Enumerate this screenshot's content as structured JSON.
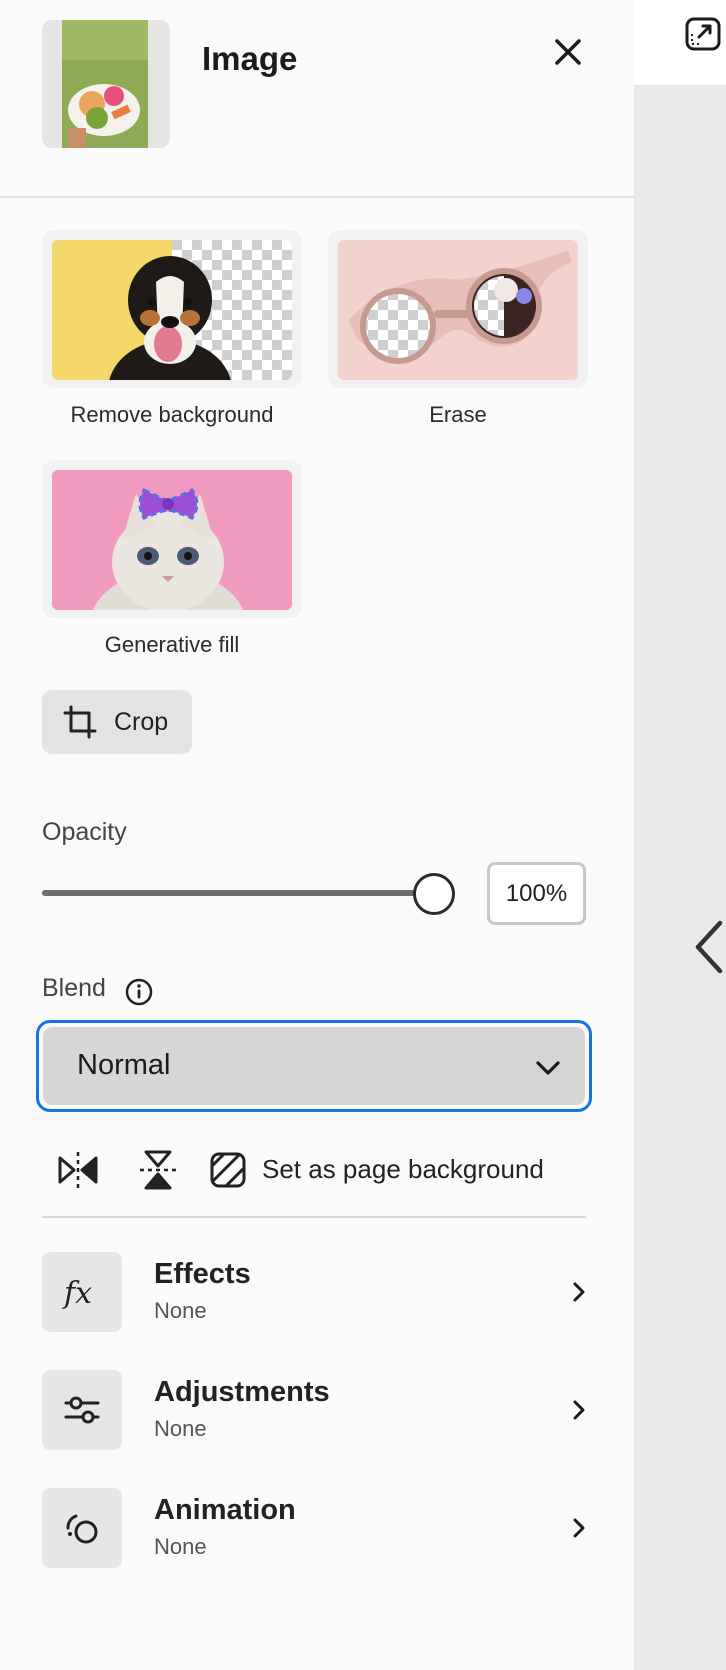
{
  "panel": {
    "title": "Image",
    "tools": [
      {
        "label": "Remove background"
      },
      {
        "label": "Erase"
      },
      {
        "label": "Generative fill"
      }
    ],
    "crop_label": "Crop",
    "opacity": {
      "label": "Opacity",
      "value": 100,
      "value_text": "100%"
    },
    "blend": {
      "label": "Blend",
      "selected": "Normal"
    },
    "quick_actions": {
      "flip_horizontal": "flip-horizontal-icon",
      "flip_vertical": "flip-vertical-icon",
      "set_background_label": "Set as page background"
    },
    "rows": [
      {
        "name": "Effects",
        "value": "None",
        "icon": "fx-icon"
      },
      {
        "name": "Adjustments",
        "value": "None",
        "icon": "sliders-icon"
      },
      {
        "name": "Animation",
        "value": "None",
        "icon": "animation-icon"
      }
    ]
  },
  "colors": {
    "accent": "#1473e6",
    "panel_bg": "#fafafa",
    "canvas_bg": "#e9e9e9"
  }
}
